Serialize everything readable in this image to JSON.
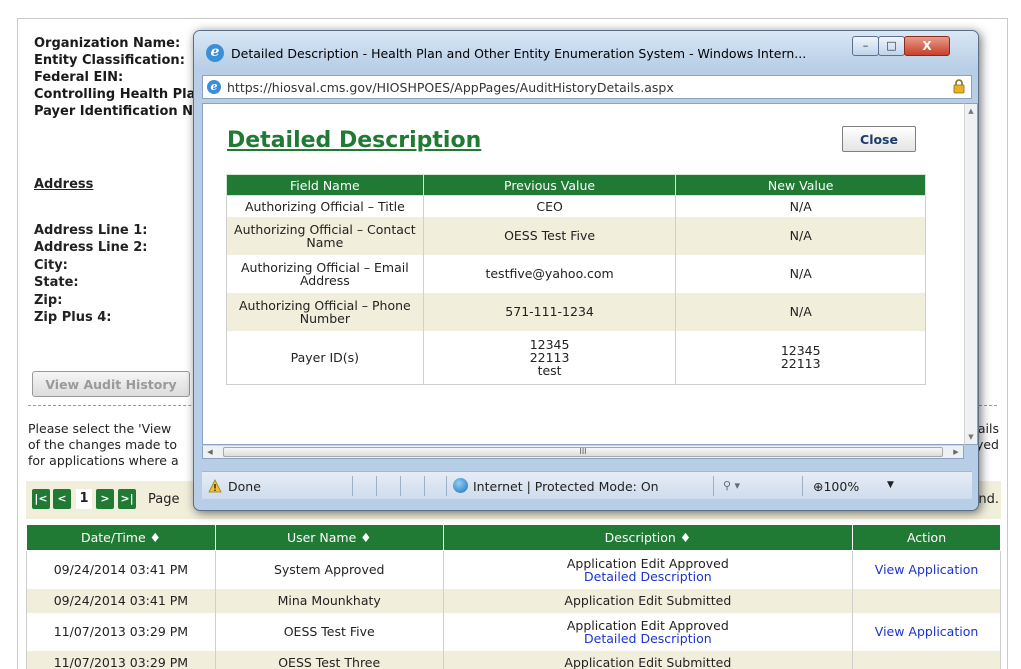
{
  "background": {
    "org_labels": [
      "Organization Name:",
      "Entity Classification:",
      "Federal EIN:",
      "Controlling Health Pla",
      "Payer Identification N"
    ],
    "address_heading": "Address",
    "address_labels": [
      "Address Line 1:",
      "Address Line 2:",
      "City:",
      "State:",
      "Zip:",
      "Zip Plus 4:"
    ],
    "view_audit_history": "View Audit History",
    "instructions": [
      "Please select the 'View",
      "of the changes made to",
      "for applications where a"
    ],
    "instructions_right": [
      "ails",
      "yed"
    ],
    "pager": {
      "first": "|<",
      "prev": "<",
      "current": "1",
      "next": ">",
      "last": ">|",
      "text": "Page",
      "found": "und."
    },
    "table": {
      "headers": [
        "Date/Time ♦",
        "User Name ♦",
        "Description ♦",
        "Action"
      ],
      "rows": [
        {
          "date": "09/24/2014 03:41 PM",
          "user": "System Approved",
          "desc": "Application Edit Approved",
          "link": "Detailed Description",
          "action": "View Application"
        },
        {
          "date": "09/24/2014 03:41 PM",
          "user": "Mina Mounkhaty",
          "desc": "Application Edit Submitted",
          "link": "",
          "action": ""
        },
        {
          "date": "11/07/2013 03:29 PM",
          "user": "OESS Test Five",
          "desc": "Application Edit Approved",
          "link": "Detailed Description",
          "action": "View Application"
        },
        {
          "date": "11/07/2013 03:29 PM",
          "user": "OESS Test Three",
          "desc": "Application Edit Submitted",
          "link": "",
          "action": ""
        }
      ]
    }
  },
  "popup": {
    "window_title": "Detailed Description - Health Plan and Other Entity Enumeration System - Windows Intern...",
    "url": "https://hiosval.cms.gov/HIOSHPOES/AppPages/AuditHistoryDetails.aspx",
    "heading": "Detailed Description",
    "close_label": "Close",
    "columns": [
      "Field Name",
      "Previous Value",
      "New Value"
    ],
    "rows": [
      {
        "field": "Authorizing Official – Title",
        "prev": "CEO",
        "new": "N/A"
      },
      {
        "field": "Authorizing Official – Contact Name",
        "prev": "OESS Test Five",
        "new": "N/A"
      },
      {
        "field": "Authorizing Official – Email Address",
        "prev": "testfive@yahoo.com",
        "new": "N/A"
      },
      {
        "field": "Authorizing Official – Phone Number",
        "prev": "571-111-1234",
        "new": "N/A"
      },
      {
        "field": "Payer ID(s)",
        "prev": "12345\n22113\ntest",
        "new": "12345\n22113"
      }
    ],
    "status": {
      "done": "Done",
      "zone": "Internet | Protected Mode: On",
      "zoom": "100%"
    },
    "hscroll_grip": "III"
  }
}
